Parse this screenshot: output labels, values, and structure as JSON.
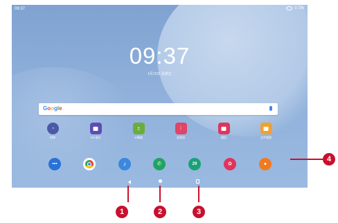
{
  "status_bar": {
    "time": "09:37",
    "battery": "≡ 1%"
  },
  "lock": {
    "clock": "09:37",
    "date": "1月15日 星期五"
  },
  "search": {
    "brand": "Google"
  },
  "apps": [
    {
      "label": "时钟",
      "color": "#4c58a8",
      "icon": "clock-icon"
    },
    {
      "label": "FM 电台",
      "color": "#5c4fb0",
      "icon": "radio-icon"
    },
    {
      "label": "计算器",
      "color": "#6cac3c",
      "icon": "calculator-icon"
    },
    {
      "label": "录音机",
      "color": "#e04468",
      "icon": "recorder-icon"
    },
    {
      "label": "相机",
      "color": "#e0345c",
      "icon": "camera-icon"
    },
    {
      "label": "文件管理",
      "color": "#f2a12e",
      "icon": "folder-icon"
    }
  ],
  "dock": [
    {
      "name": "messages",
      "color": "#2a72d6",
      "icon": "messages-icon"
    },
    {
      "name": "chrome",
      "color": "#ffffff",
      "icon": "chrome-icon"
    },
    {
      "name": "music",
      "color": "#3b88dd",
      "icon": "music-icon"
    },
    {
      "name": "phone",
      "color": "#1fa463",
      "icon": "phone-icon"
    },
    {
      "name": "calendar",
      "color": "#1aa277",
      "icon": "calendar-icon",
      "text": "29"
    },
    {
      "name": "gallery",
      "color": "#e0345c",
      "icon": "gallery-icon"
    },
    {
      "name": "contacts",
      "color": "#f07a22",
      "icon": "contacts-icon"
    }
  ],
  "callouts": [
    "1",
    "2",
    "3",
    "4"
  ],
  "accent": "#c8102e"
}
